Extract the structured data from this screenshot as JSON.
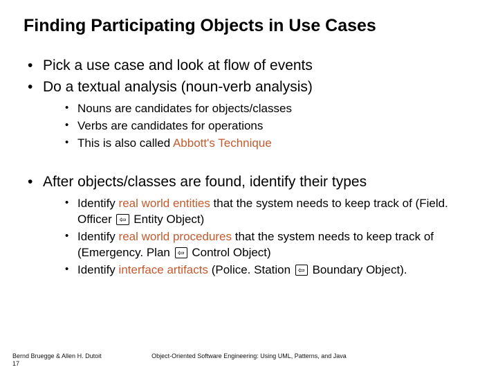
{
  "title": "Finding Participating Objects in Use Cases",
  "b1": "Pick a use case and look at flow of events",
  "b2": "Do a textual analysis (noun-verb analysis)",
  "b2a": "Nouns are candidates for objects/classes",
  "b2b": "Verbs are candidates for operations",
  "b2c_pre": "This is also called ",
  "b2c_accent": "Abbott's Technique",
  "b3": "After objects/classes are found, identify their types",
  "b3a_p1": "Identify ",
  "b3a_a": "real world entities",
  "b3a_p2": " that the system needs to keep track of (Field. Officer ",
  "b3a_p3": " Entity Object)",
  "b3b_p1": "Identify ",
  "b3b_a": "real world procedures",
  "b3b_p2": " that the system needs to keep track of (Emergency. Plan ",
  "b3b_p3": " Control Object)",
  "b3c_p1": "Identify ",
  "b3c_a": "interface artifacts",
  "b3c_p2": " (Police. Station ",
  "b3c_p3": " Boundary Object).",
  "arrow": "⇦",
  "footer_author": "Bernd Bruegge & Allen H. Dutoit",
  "footer_page": "17",
  "footer_book": "Object-Oriented Software Engineering: Using UML, Patterns, and Java"
}
